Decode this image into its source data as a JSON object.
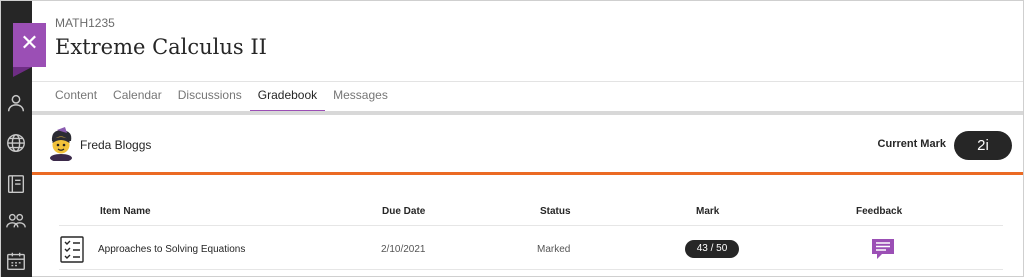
{
  "course": {
    "code": "MATH1235",
    "title": "Extreme Calculus II"
  },
  "close_icon": "close-icon",
  "colors": {
    "accent": "#9b4fb5",
    "divider_orange": "#eb6a23",
    "rail": "#262626"
  },
  "tabs": [
    {
      "label": "Content",
      "active": false
    },
    {
      "label": "Calendar",
      "active": false
    },
    {
      "label": "Discussions",
      "active": false
    },
    {
      "label": "Gradebook",
      "active": true
    },
    {
      "label": "Messages",
      "active": false
    }
  ],
  "rail_icons": [
    "user-icon",
    "globe-icon",
    "gradebook-book-icon",
    "people-icon",
    "calendar-icon"
  ],
  "student": {
    "name": "Freda Bloggs"
  },
  "current_mark": {
    "label": "Current Mark",
    "value": "2i"
  },
  "table": {
    "headers": {
      "item": "Item Name",
      "due": "Due Date",
      "status": "Status",
      "mark": "Mark",
      "feedback": "Feedback"
    },
    "rows": [
      {
        "icon": "assignment-checklist-icon",
        "item": "Approaches to Solving Equations",
        "due": "2/10/2021",
        "status": "Marked",
        "mark": "43 / 50",
        "feedback_icon": "feedback-message-icon"
      }
    ]
  }
}
